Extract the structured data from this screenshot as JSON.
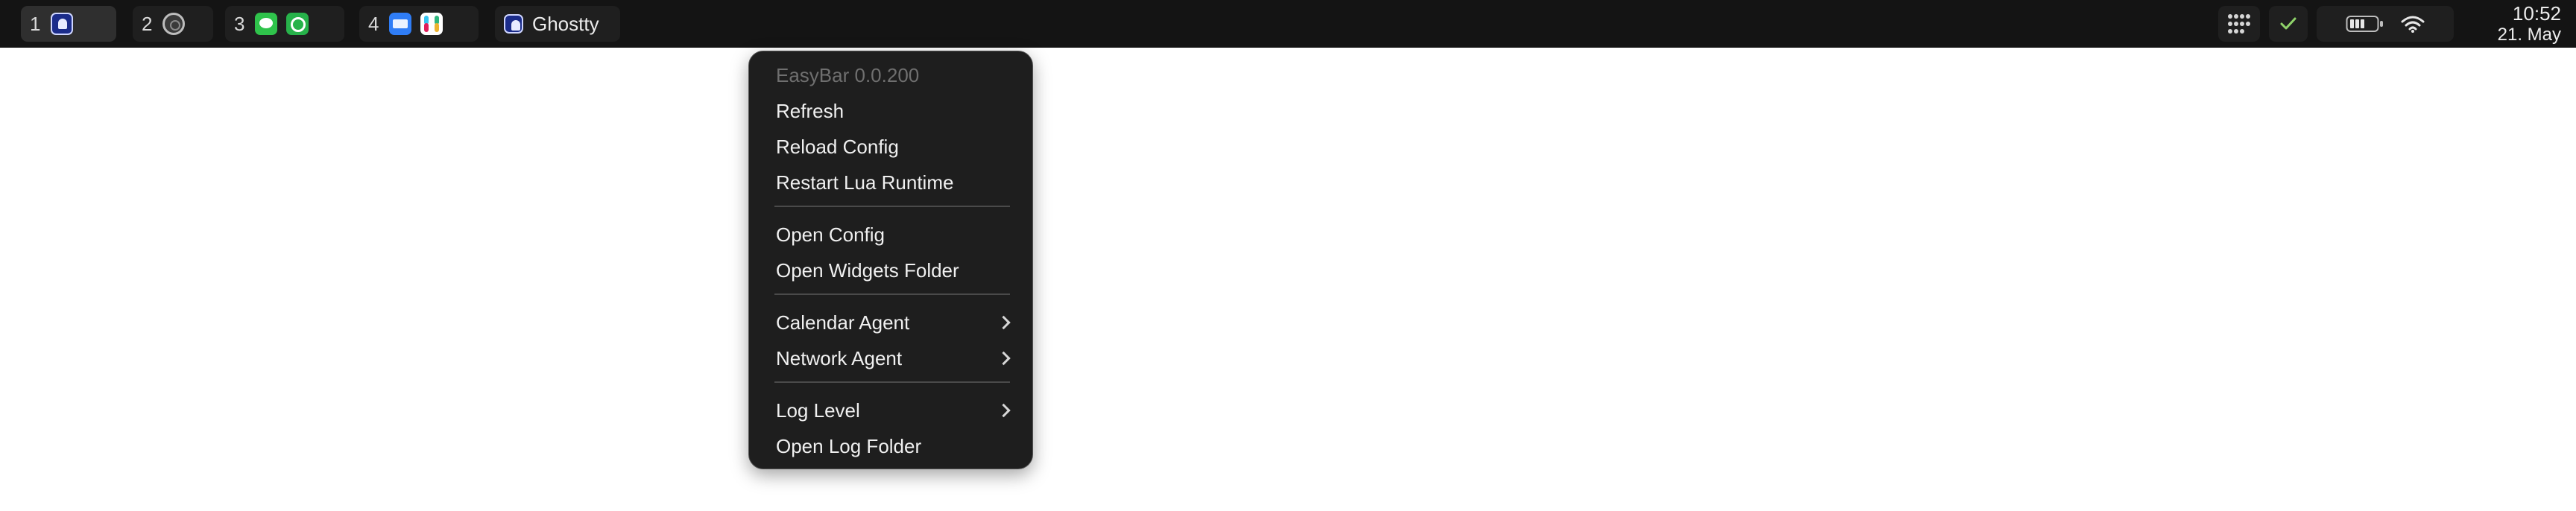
{
  "menubar": {
    "workspaces": [
      {
        "number": "1",
        "apps": [
          "ghostty-icon"
        ],
        "active": true
      },
      {
        "number": "2",
        "apps": [
          "gear-icon"
        ]
      },
      {
        "number": "3",
        "apps": [
          "messages-icon",
          "whatsapp-icon"
        ]
      },
      {
        "number": "4",
        "apps": [
          "mail-icon",
          "slack-icon"
        ]
      }
    ],
    "front_app": {
      "icon": "ghostty-icon",
      "name": "Ghostty"
    },
    "status": {
      "control_icon": "grid-dots-icon",
      "check_icon": "checkmark-icon",
      "battery_icon": "battery-icon",
      "wifi_icon": "wifi-icon"
    },
    "clock": {
      "time": "10:52",
      "date": "21. May"
    }
  },
  "menu": {
    "header": "EasyBar 0.0.200",
    "groups": [
      [
        "Refresh",
        "Reload Config",
        "Restart Lua Runtime"
      ],
      [
        "Open Config",
        "Open Widgets Folder"
      ],
      [
        "Calendar Agent",
        "Network Agent"
      ],
      [
        "Log Level",
        "Open Log Folder"
      ]
    ],
    "submenu_items": [
      "Calendar Agent",
      "Network Agent",
      "Log Level"
    ]
  },
  "colors": {
    "menubar_bg": "#141414",
    "menu_bg": "#1e1e1e",
    "accent_check": "#8fd36a"
  }
}
